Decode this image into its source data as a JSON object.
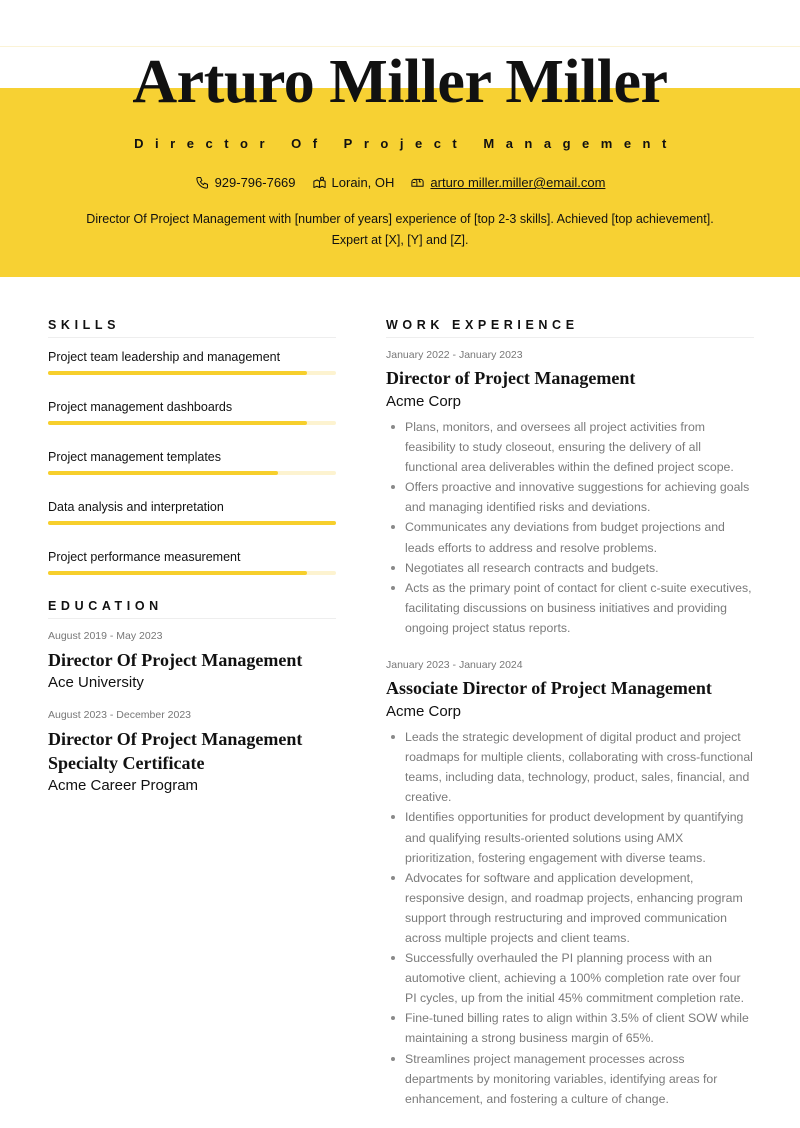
{
  "header": {
    "name": "Arturo Miller Miller",
    "headline": "Director Of Project Management",
    "contact": {
      "phone": "929-796-7669",
      "location": "Lorain, OH",
      "email": "arturo miller.miller@email.com"
    },
    "summary": "Director Of Project Management with [number of years] experience of [top 2-3 skills]. Achieved [top achievement]. Expert at [X], [Y] and [Z].",
    "accent_color": "#f7d133"
  },
  "skills": {
    "title": "SKILLS",
    "items": [
      {
        "label": "Project team leadership and management",
        "level": 0.9
      },
      {
        "label": "Project management dashboards",
        "level": 0.9
      },
      {
        "label": "Project management templates",
        "level": 0.8
      },
      {
        "label": "Data analysis and interpretation",
        "level": 1.0
      },
      {
        "label": "Project performance measurement",
        "level": 0.9
      }
    ]
  },
  "education": {
    "title": "EDUCATION",
    "items": [
      {
        "dates": "August 2019 - May 2023",
        "degree": "Director Of Project Management",
        "school": "Ace University"
      },
      {
        "dates": "August 2023 - December 2023",
        "degree": "Director Of Project Management Specialty Certificate",
        "school": "Acme Career Program"
      }
    ]
  },
  "experience": {
    "title": "WORK EXPERIENCE",
    "items": [
      {
        "dates": "January 2022 - January 2023",
        "title": "Director of Project Management",
        "company": "Acme Corp",
        "bullets": [
          "Plans, monitors, and oversees all project activities from feasibility to study closeout, ensuring the delivery of all functional area deliverables within the defined project scope.",
          "Offers proactive and innovative suggestions for achieving goals and managing identified risks and deviations.",
          "Communicates any deviations from budget projections and leads efforts to address and resolve problems.",
          "Negotiates all research contracts and budgets.",
          "Acts as the primary point of contact for client c-suite executives, facilitating discussions on business initiatives and providing ongoing project status reports."
        ]
      },
      {
        "dates": "January 2023 - January 2024",
        "title": "Associate Director of Project Management",
        "company": "Acme Corp",
        "bullets": [
          "Leads the strategic development of digital product and project roadmaps for multiple clients, collaborating with cross-functional teams, including data, technology, product, sales, financial, and creative.",
          "Identifies opportunities for product development by quantifying and qualifying results-oriented solutions using AMX prioritization, fostering engagement with diverse teams.",
          "Advocates for software and application development, responsive design, and roadmap projects, enhancing program support through restructuring and improved communication across multiple projects and client teams.",
          "Successfully overhauled the PI planning process with an automotive client, achieving a 100% completion rate over four PI cycles, up from the initial 45% commitment completion rate.",
          "Fine-tuned billing rates to align within 3.5% of client SOW while maintaining a strong business margin of 65%.",
          "Streamlines project management processes across departments by monitoring variables, identifying areas for enhancement, and fostering a culture of change."
        ]
      }
    ]
  }
}
